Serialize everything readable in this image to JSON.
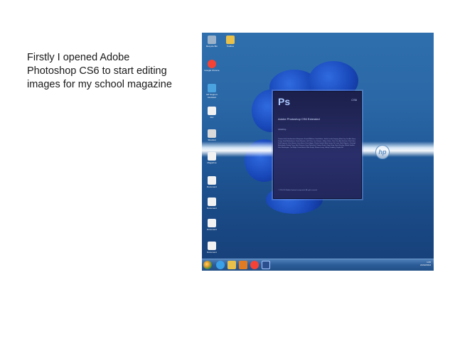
{
  "slide": {
    "caption_lines": [
      "Firstly I opened Adobe",
      "Photoshop CS6 to start editing",
      "images for my school magazine"
    ]
  },
  "desktop": {
    "icons": [
      {
        "name": "recycle-bin-icon",
        "label": "Recycle Bin",
        "color": "#9bb2c9"
      },
      {
        "name": "toolbox-icon",
        "label": "Toolbox",
        "color": "#e8c04a"
      },
      {
        "name": "chrome-icon",
        "label": "Google Chrome",
        "color": "#f44336"
      },
      {
        "name": "hp-support-icon",
        "label": "HP Support Assistant",
        "color": "#4aa3df"
      },
      {
        "name": "document-icon",
        "label": "doc",
        "color": "#f2f2f2"
      },
      {
        "name": "shortcut-icon",
        "label": "Shortcut",
        "color": "#d9d9d9"
      },
      {
        "name": "document-icon",
        "label": "Magazine",
        "color": "#f2f2f2"
      },
      {
        "name": "document-icon",
        "label": "Document",
        "color": "#f2f2f2"
      },
      {
        "name": "document-icon",
        "label": "Document",
        "color": "#f2f2f2"
      },
      {
        "name": "document-icon",
        "label": "Document",
        "color": "#f2f2f2"
      },
      {
        "name": "document-icon",
        "label": "Document",
        "color": "#f2f2f2"
      }
    ],
    "hp_logo_text": "hp"
  },
  "photoshop_splash": {
    "logo": "Ps",
    "version_short": "CS6",
    "title": "Adobe Photoshop CS6 Extended",
    "loading_text": "Initializing...",
    "credits": "Thomas Knoll, Seetharaman Narayanan, Russell Williams, David Howe, Jackie Lincoln-Owyang, Maria Yap, Joe Ault, Barry Young, Vinod Balakrishnan, Foster Brereton, Jeff Chien, Jon Clauson, Jeffrey Cohen, Chris Cox, Alan Erickson, Pete Falco, Paul Ferguson, John Hanson, Jerry Harris, Kevin Hopps, Chintan Intwala, Betty Leong, Tai Luxon, Mark Maguire, Christoph Moskalonek, Renbin Peng, John Peterson, Dave Polaschek, Thomas Ruark, Yuyan Song, Sarah Stuckey, Nikolai Svakhin, John Worthington, Tim Wright, David Hackel, Mike Keogh, Wennie Leung, Jeffrey Tranberry, Yinglan Ma",
    "copyright": "© 1990-2012 Adobe Systems Incorporated. All rights reserved."
  },
  "taskbar": {
    "items": [
      {
        "name": "start-orb-icon",
        "color": "#e59b2a"
      },
      {
        "name": "ie-icon",
        "color": "#3aa0e8"
      },
      {
        "name": "folder-icon",
        "color": "#e8c04a"
      },
      {
        "name": "media-player-icon",
        "color": "#e07b24"
      },
      {
        "name": "chrome-icon",
        "color": "#f44336"
      },
      {
        "name": "photoshop-taskbar-icon",
        "color": "#2a4f8f"
      }
    ],
    "time": "1:05",
    "date": "21/02/2014"
  }
}
